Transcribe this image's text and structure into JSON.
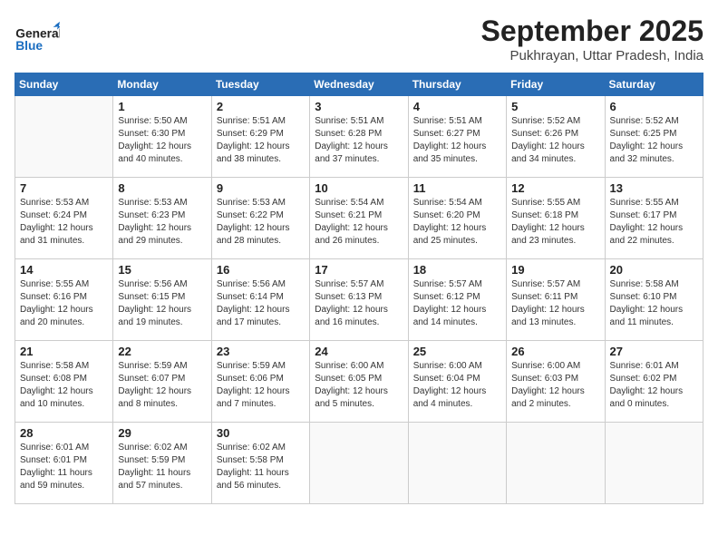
{
  "header": {
    "logo_general": "General",
    "logo_blue": "Blue",
    "month_title": "September 2025",
    "subtitle": "Pukhrayan, Uttar Pradesh, India"
  },
  "days_of_week": [
    "Sunday",
    "Monday",
    "Tuesday",
    "Wednesday",
    "Thursday",
    "Friday",
    "Saturday"
  ],
  "weeks": [
    [
      {
        "day": "",
        "info": ""
      },
      {
        "day": "1",
        "info": "Sunrise: 5:50 AM\nSunset: 6:30 PM\nDaylight: 12 hours\nand 40 minutes."
      },
      {
        "day": "2",
        "info": "Sunrise: 5:51 AM\nSunset: 6:29 PM\nDaylight: 12 hours\nand 38 minutes."
      },
      {
        "day": "3",
        "info": "Sunrise: 5:51 AM\nSunset: 6:28 PM\nDaylight: 12 hours\nand 37 minutes."
      },
      {
        "day": "4",
        "info": "Sunrise: 5:51 AM\nSunset: 6:27 PM\nDaylight: 12 hours\nand 35 minutes."
      },
      {
        "day": "5",
        "info": "Sunrise: 5:52 AM\nSunset: 6:26 PM\nDaylight: 12 hours\nand 34 minutes."
      },
      {
        "day": "6",
        "info": "Sunrise: 5:52 AM\nSunset: 6:25 PM\nDaylight: 12 hours\nand 32 minutes."
      }
    ],
    [
      {
        "day": "7",
        "info": "Sunrise: 5:53 AM\nSunset: 6:24 PM\nDaylight: 12 hours\nand 31 minutes."
      },
      {
        "day": "8",
        "info": "Sunrise: 5:53 AM\nSunset: 6:23 PM\nDaylight: 12 hours\nand 29 minutes."
      },
      {
        "day": "9",
        "info": "Sunrise: 5:53 AM\nSunset: 6:22 PM\nDaylight: 12 hours\nand 28 minutes."
      },
      {
        "day": "10",
        "info": "Sunrise: 5:54 AM\nSunset: 6:21 PM\nDaylight: 12 hours\nand 26 minutes."
      },
      {
        "day": "11",
        "info": "Sunrise: 5:54 AM\nSunset: 6:20 PM\nDaylight: 12 hours\nand 25 minutes."
      },
      {
        "day": "12",
        "info": "Sunrise: 5:55 AM\nSunset: 6:18 PM\nDaylight: 12 hours\nand 23 minutes."
      },
      {
        "day": "13",
        "info": "Sunrise: 5:55 AM\nSunset: 6:17 PM\nDaylight: 12 hours\nand 22 minutes."
      }
    ],
    [
      {
        "day": "14",
        "info": "Sunrise: 5:55 AM\nSunset: 6:16 PM\nDaylight: 12 hours\nand 20 minutes."
      },
      {
        "day": "15",
        "info": "Sunrise: 5:56 AM\nSunset: 6:15 PM\nDaylight: 12 hours\nand 19 minutes."
      },
      {
        "day": "16",
        "info": "Sunrise: 5:56 AM\nSunset: 6:14 PM\nDaylight: 12 hours\nand 17 minutes."
      },
      {
        "day": "17",
        "info": "Sunrise: 5:57 AM\nSunset: 6:13 PM\nDaylight: 12 hours\nand 16 minutes."
      },
      {
        "day": "18",
        "info": "Sunrise: 5:57 AM\nSunset: 6:12 PM\nDaylight: 12 hours\nand 14 minutes."
      },
      {
        "day": "19",
        "info": "Sunrise: 5:57 AM\nSunset: 6:11 PM\nDaylight: 12 hours\nand 13 minutes."
      },
      {
        "day": "20",
        "info": "Sunrise: 5:58 AM\nSunset: 6:10 PM\nDaylight: 12 hours\nand 11 minutes."
      }
    ],
    [
      {
        "day": "21",
        "info": "Sunrise: 5:58 AM\nSunset: 6:08 PM\nDaylight: 12 hours\nand 10 minutes."
      },
      {
        "day": "22",
        "info": "Sunrise: 5:59 AM\nSunset: 6:07 PM\nDaylight: 12 hours\nand 8 minutes."
      },
      {
        "day": "23",
        "info": "Sunrise: 5:59 AM\nSunset: 6:06 PM\nDaylight: 12 hours\nand 7 minutes."
      },
      {
        "day": "24",
        "info": "Sunrise: 6:00 AM\nSunset: 6:05 PM\nDaylight: 12 hours\nand 5 minutes."
      },
      {
        "day": "25",
        "info": "Sunrise: 6:00 AM\nSunset: 6:04 PM\nDaylight: 12 hours\nand 4 minutes."
      },
      {
        "day": "26",
        "info": "Sunrise: 6:00 AM\nSunset: 6:03 PM\nDaylight: 12 hours\nand 2 minutes."
      },
      {
        "day": "27",
        "info": "Sunrise: 6:01 AM\nSunset: 6:02 PM\nDaylight: 12 hours\nand 0 minutes."
      }
    ],
    [
      {
        "day": "28",
        "info": "Sunrise: 6:01 AM\nSunset: 6:01 PM\nDaylight: 11 hours\nand 59 minutes."
      },
      {
        "day": "29",
        "info": "Sunrise: 6:02 AM\nSunset: 5:59 PM\nDaylight: 11 hours\nand 57 minutes."
      },
      {
        "day": "30",
        "info": "Sunrise: 6:02 AM\nSunset: 5:58 PM\nDaylight: 11 hours\nand 56 minutes."
      },
      {
        "day": "",
        "info": ""
      },
      {
        "day": "",
        "info": ""
      },
      {
        "day": "",
        "info": ""
      },
      {
        "day": "",
        "info": ""
      }
    ]
  ]
}
